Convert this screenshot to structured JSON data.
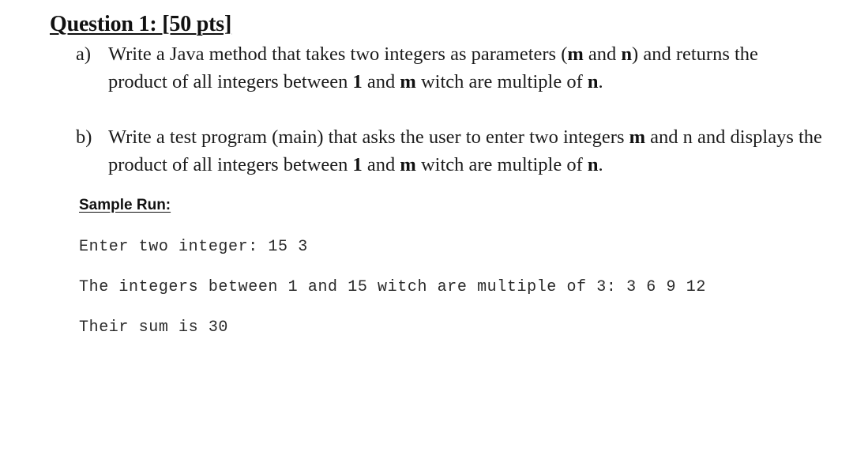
{
  "question": {
    "title": "Question 1: [50 pts]"
  },
  "parts": {
    "a": {
      "label": "a)",
      "line1": {
        "t1": "Write a Java method that takes two integers as parameters (",
        "m": "m",
        "t2": " and ",
        "n": "n",
        "t3": ") and returns the"
      },
      "line2": {
        "t1": "product of all integers between ",
        "one": "1",
        "t2": " and ",
        "m": "m",
        "t3": " witch are multiple of ",
        "n": "n",
        "t4": "."
      }
    },
    "b": {
      "label": "b)",
      "line1": {
        "t1": "Write a test program (main) that asks the user to enter two integers ",
        "m": "m",
        "t2": " and n and displays the"
      },
      "line2": {
        "t1": "product of all integers between ",
        "one": "1",
        "t2": " and ",
        "m": "m",
        "t3": " witch are multiple of ",
        "n": "n",
        "t4": "."
      }
    }
  },
  "sample_run": {
    "heading": "Sample Run:",
    "lines": [
      "Enter two integer: 15 3",
      "The integers between 1 and 15 witch are multiple of 3: 3 6 9 12",
      "Their sum is 30"
    ]
  }
}
